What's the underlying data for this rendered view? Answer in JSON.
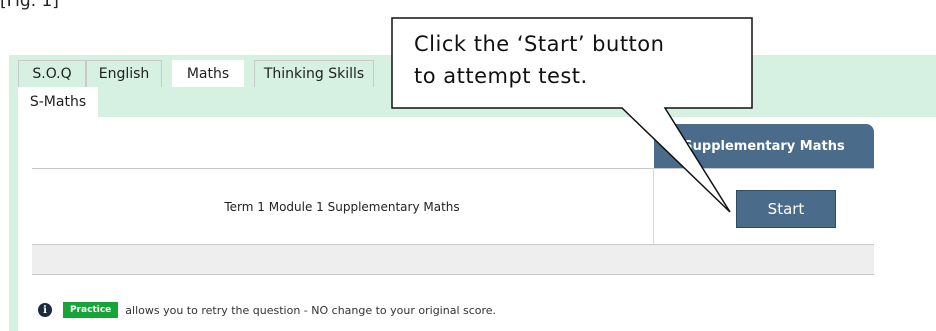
{
  "figure_label": "[Fig. 1]",
  "tabs": [
    {
      "label": "S.O.Q",
      "active": false
    },
    {
      "label": "English",
      "active": false
    },
    {
      "label": "Maths",
      "active": true
    },
    {
      "label": "Thinking Skills",
      "active": false
    }
  ],
  "subtabs": [
    {
      "label": "S-Maths",
      "active": true
    }
  ],
  "table": {
    "column_header": "Supplementary Maths",
    "rows": [
      {
        "name": "Term 1 Module 1 Supplementary Maths",
        "button_label": "Start"
      }
    ]
  },
  "info": {
    "badge": "Practice",
    "text": "allows you to retry the question - NO change to your original score."
  },
  "callout": {
    "line1": "Click the ‘Start’ button",
    "line2": "to attempt test."
  },
  "colors": {
    "tab_bg": "#d6f1e2",
    "header_blue": "#4a6c8a",
    "badge_green": "#17a53a"
  },
  "icons": [
    "info-icon"
  ]
}
